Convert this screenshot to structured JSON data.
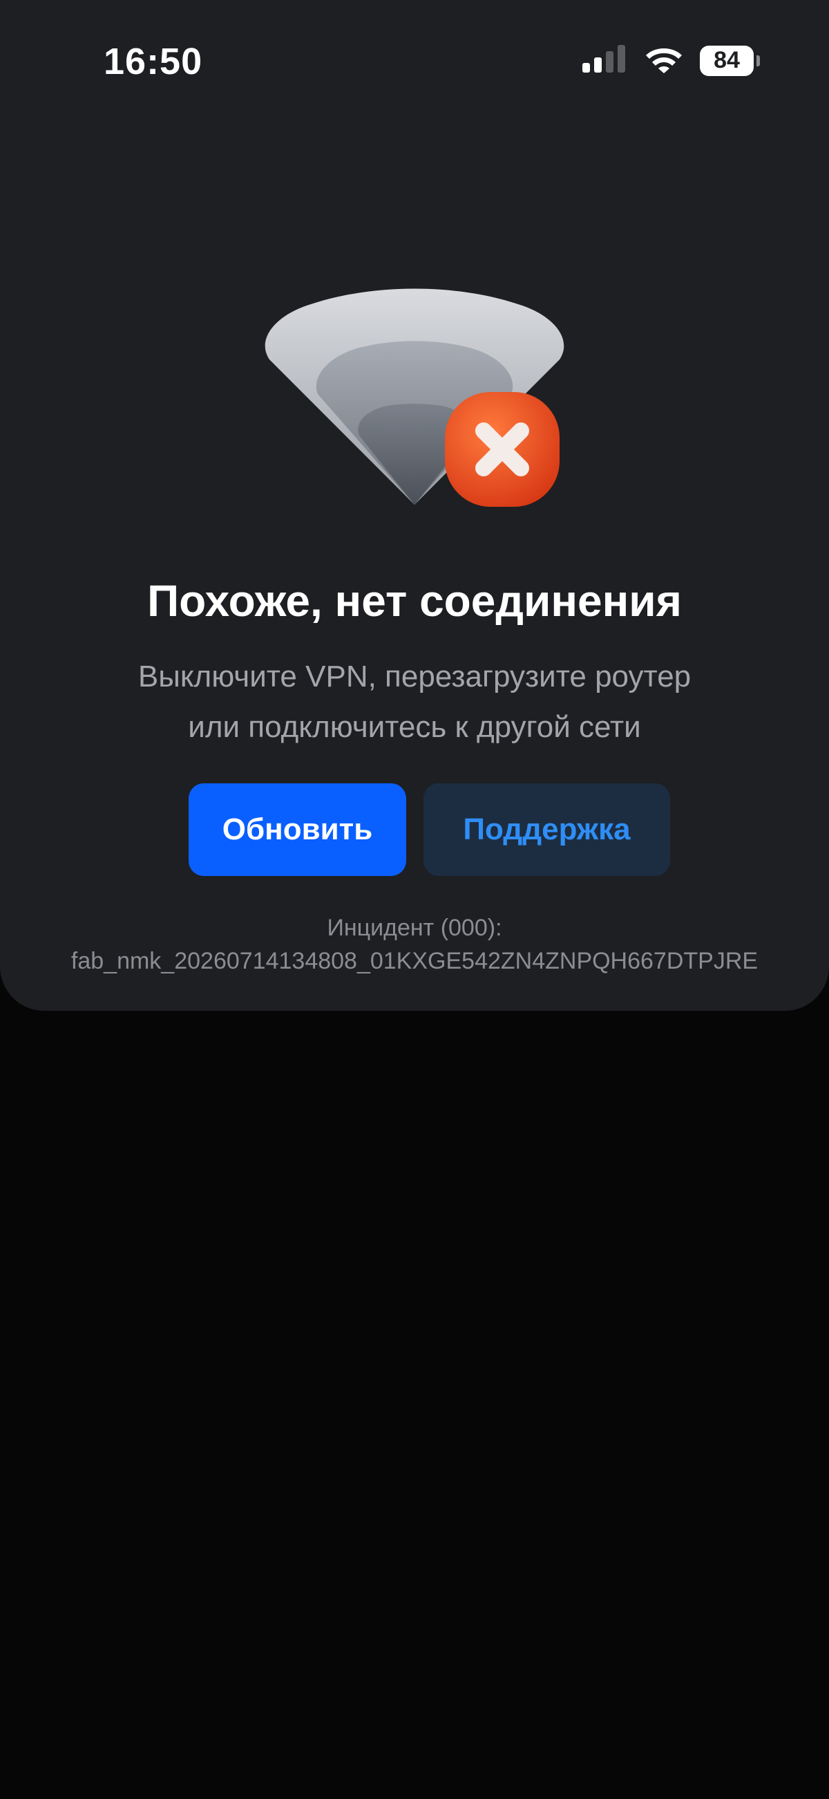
{
  "status_bar": {
    "time": "16:50",
    "battery_level": "84"
  },
  "illustration": {
    "icon": "wifi-error-icon",
    "badge_icon": "close-icon",
    "badge_color": "#e8431b"
  },
  "content": {
    "title": "Похоже, нет соединения",
    "subtitle_line1": "Выключите VPN, перезагрузите роутер",
    "subtitle_line2": "или подключитесь к другой сети"
  },
  "actions": {
    "refresh_label": "Обновить",
    "support_label": "Поддержка"
  },
  "incident": {
    "label": "Инцидент (000):",
    "code": "fab_nmk_20260714134808_01KXGE542ZN4ZNPQH667DTPJRE"
  },
  "colors": {
    "accent": "#0a60ff",
    "support_bg": "#1c2d42",
    "support_text": "#2f8ef5",
    "card_bg": "#1e1f22"
  }
}
